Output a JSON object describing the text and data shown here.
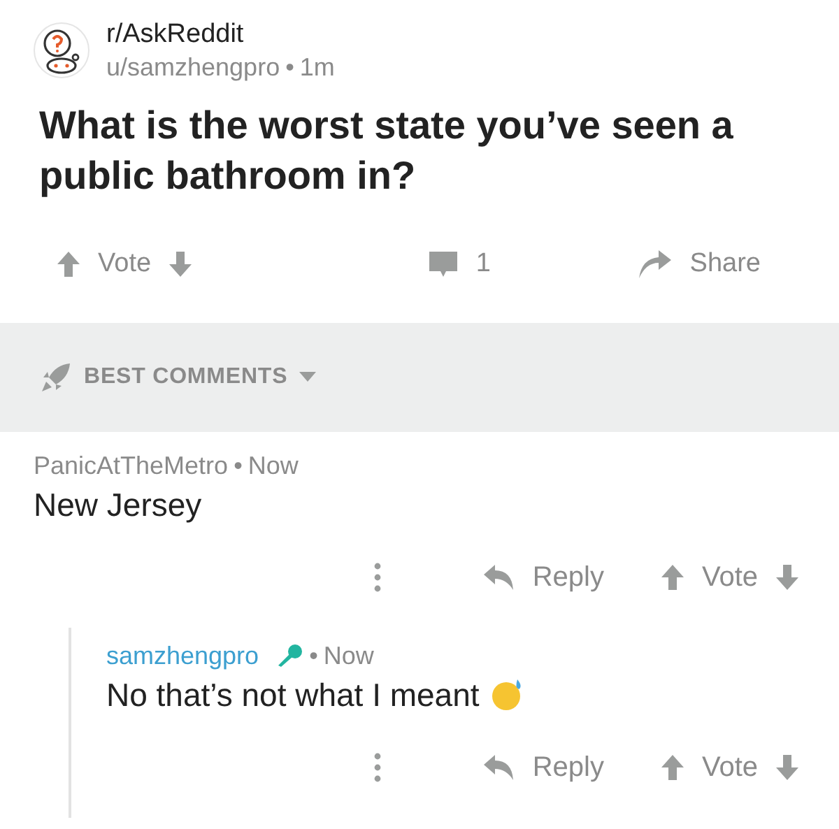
{
  "post": {
    "subreddit": "r/AskReddit",
    "author": "u/samzhengpro",
    "separator": "•",
    "age": "1m",
    "title": "What is the worst state you’ve seen a public bathroom in?"
  },
  "actions": {
    "vote": "Vote",
    "comments": "1",
    "share": "Share"
  },
  "sort": {
    "label": "BEST COMMENTS"
  },
  "comments": [
    {
      "author": "PanicAtTheMetro",
      "op": false,
      "separator": "•",
      "age": "Now",
      "body": "New Jersey",
      "emoji": false,
      "reply": "Reply",
      "vote": "Vote",
      "children": [
        {
          "author": "samzhengpro",
          "op": true,
          "separator": "•",
          "age": "Now",
          "body": "No that’s not what I meant",
          "emoji": true,
          "reply": "Reply",
          "vote": "Vote"
        }
      ]
    }
  ]
}
